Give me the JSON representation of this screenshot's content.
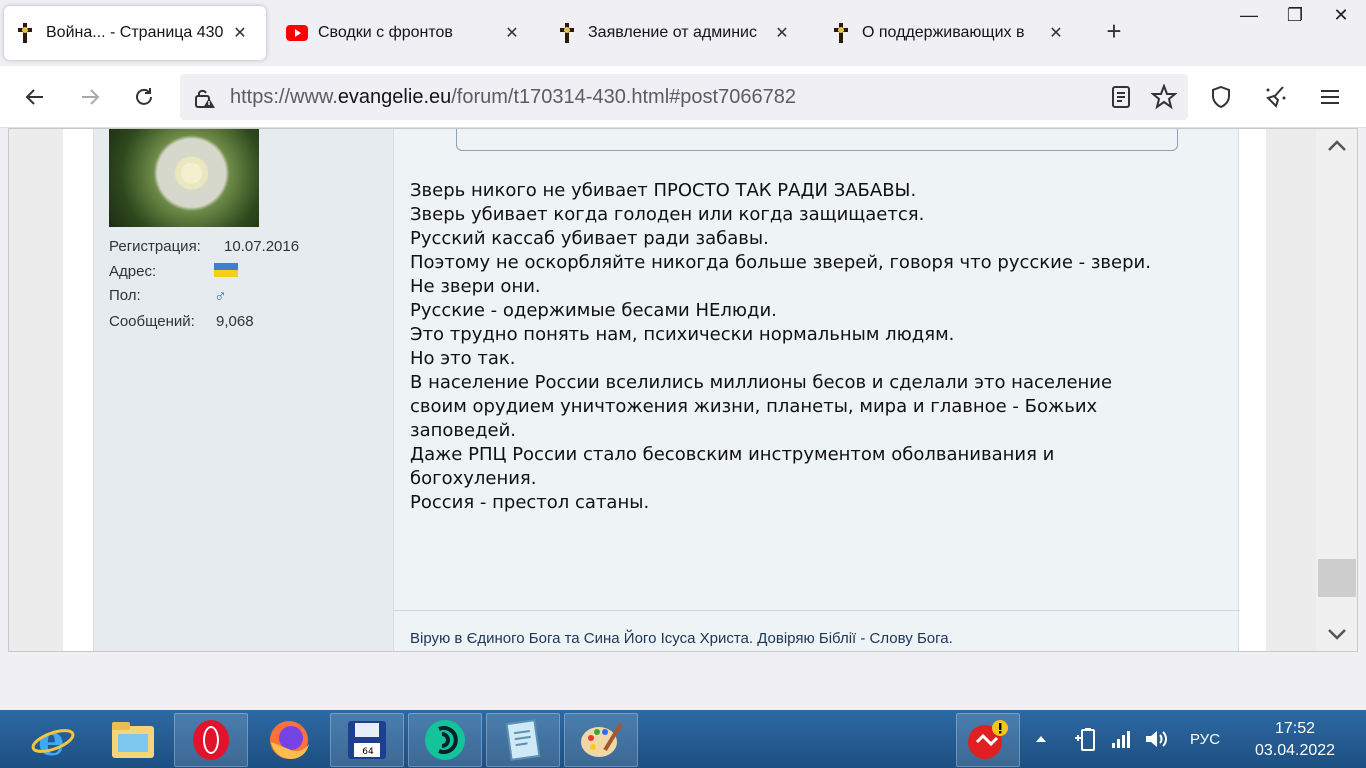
{
  "tabs": [
    {
      "label": "Война... - Страница 430",
      "active": true,
      "icon": "cross-icon"
    },
    {
      "label": "Сводки с фронтов",
      "active": false,
      "icon": "youtube-icon"
    },
    {
      "label": "Заявление от админис",
      "active": false,
      "icon": "cross-icon"
    },
    {
      "label": "О поддерживающих в",
      "active": false,
      "icon": "cross-icon"
    }
  ],
  "window": {
    "minimize": "—",
    "maximize": "❐",
    "close": "✕"
  },
  "url": {
    "scheme": "https://www.",
    "host": "evangelie.eu",
    "path": "/forum/t170314-430.html#post7066782"
  },
  "user": {
    "fields": [
      {
        "label": "Регистрация:",
        "value": "10.07.2016"
      },
      {
        "label": "Адрес:",
        "value": ""
      },
      {
        "label": "Пол:",
        "value": "♂"
      },
      {
        "label": "Сообщений:",
        "value": "9,068"
      }
    ]
  },
  "post": {
    "lines": [
      "Зверь никого не убивает ПРОСТО ТАК РАДИ ЗАБАВЫ.",
      "Зверь убивает когда голоден или когда защищается.",
      "Русский кассаб убивает ради забавы.",
      "Поэтому не оскорбляйте никогда больше зверей, говоря что русские - звери.",
      "Не звери они.",
      "Русские - одержимые бесами НЕлюди.",
      "Это трудно понять нам, психически нормальным людям.",
      "Но это так.",
      "В население России вселились миллионы бесов и сделали это население",
      "своим орудием уничтожения жизни, планеты, мира и главное - Божьих",
      "заповедей.",
      "Даже РПЦ России стало бесовским инструментом оболванивания и",
      "богохуления.",
      "Россия - престол сатаны."
    ],
    "signature": "Вірую в Єдиного Бога та Сина Його Ісуса Христа. Довіряю Біблії - Слову Бога."
  },
  "taskbar": {
    "apps": [
      "ie-icon",
      "explorer-icon",
      "opera-icon",
      "firefox-icon",
      "save-icon",
      "browser-icon",
      "notepad-icon",
      "paint-icon"
    ],
    "language": "РУС",
    "time": "17:52",
    "date": "03.04.2022"
  }
}
